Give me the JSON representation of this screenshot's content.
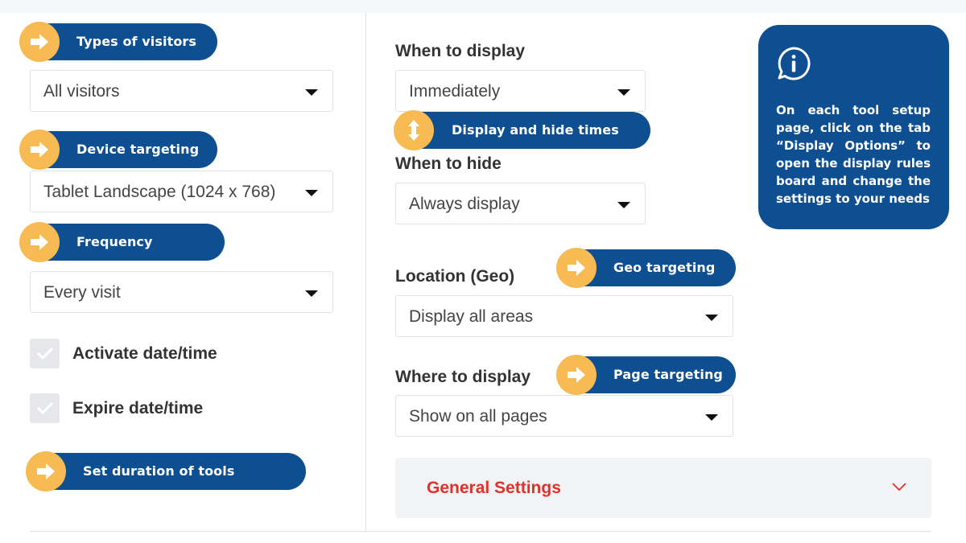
{
  "left_panel": {
    "visitors": {
      "tag": "Types of visitors",
      "value": "All visitors"
    },
    "device": {
      "tag": "Device targeting",
      "value": "Tablet Landscape (1024 x 768)"
    },
    "frequency": {
      "tag": "Frequency",
      "value": "Every visit"
    },
    "activate_label": "Activate date/time",
    "expire_label": "Expire date/time",
    "duration_tag": "Set duration of tools"
  },
  "right_panel": {
    "when_display": {
      "label": "When to display",
      "value": "Immediately"
    },
    "times_tag": "Display and hide times",
    "when_hide": {
      "label": "When to hide",
      "value": "Always display"
    },
    "location": {
      "label": "Location (Geo)",
      "tag": "Geo targeting",
      "value": "Display all areas"
    },
    "where_display": {
      "label": "Where to display",
      "tag": "Page targeting",
      "value": "Show on all pages"
    },
    "general_settings": "General Settings"
  },
  "info_card": {
    "icon": "info-bubble-icon",
    "text": "On each tool setup page, click on the tab “Display Options” to open the display rules board and change the settings to your needs"
  },
  "colors": {
    "tag_blue": "#0e4f92",
    "tag_orange": "#f8bb54",
    "accent_red": "#e0312b"
  }
}
